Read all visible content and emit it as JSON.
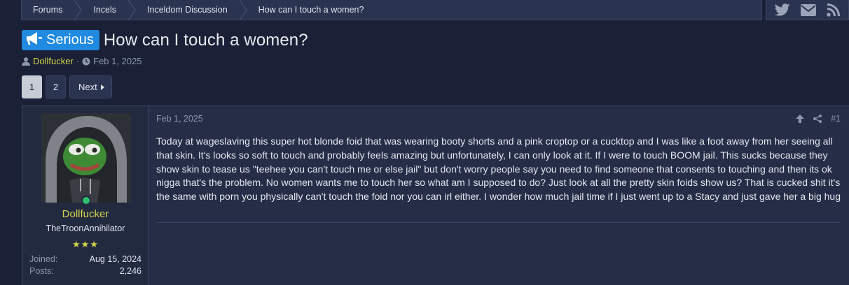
{
  "breadcrumb": [
    "Forums",
    "Incels",
    "Inceldom Discussion",
    "How can I touch a women?"
  ],
  "social": [
    "twitter-icon",
    "mail-icon",
    "rss-icon"
  ],
  "thread": {
    "prefix": "Serious",
    "title": "How can I touch a women?",
    "author": "Dollfucker",
    "date": "Feb 1, 2025"
  },
  "pagination": {
    "pages": [
      "1",
      "2"
    ],
    "current": "1",
    "next_label": "Next"
  },
  "post": {
    "user": {
      "name": "Dollfucker",
      "title": "TheTroonAnnihilator",
      "stars": "★★★",
      "online": true,
      "joined_label": "Joined:",
      "joined": "Aug 15, 2024",
      "posts_label": "Posts:",
      "posts": "2,246"
    },
    "date": "Feb 1, 2025",
    "number": "#1",
    "body": "Today at wageslaving this super hot blonde foid that was wearing booty shorts and a pink croptop or a cucktop and I was like a foot away from her seeing all that skin. It's looks so soft to touch and probably feels amazing but unfortunately, I can only look at it. If I were to touch BOOM jail. This sucks because they show skin to tease us \"teehee you can't touch me or else jail\" but don't worry people say you need to find someone that consents to touching and then its ok nigga that's the problem. No women wants me to touch her so what am I supposed to do? Just look at all the pretty skin foids show us? That is cucked shit it's the same with porn you physically can't touch the foid nor you can irl either. I wonder how much jail time if I just went up to a Stacy and just gave her a big hug"
  },
  "colors": {
    "accent": "#1f8ae0",
    "username": "#d2d54a",
    "online": "#2ec06b",
    "background": "#1a2035"
  }
}
